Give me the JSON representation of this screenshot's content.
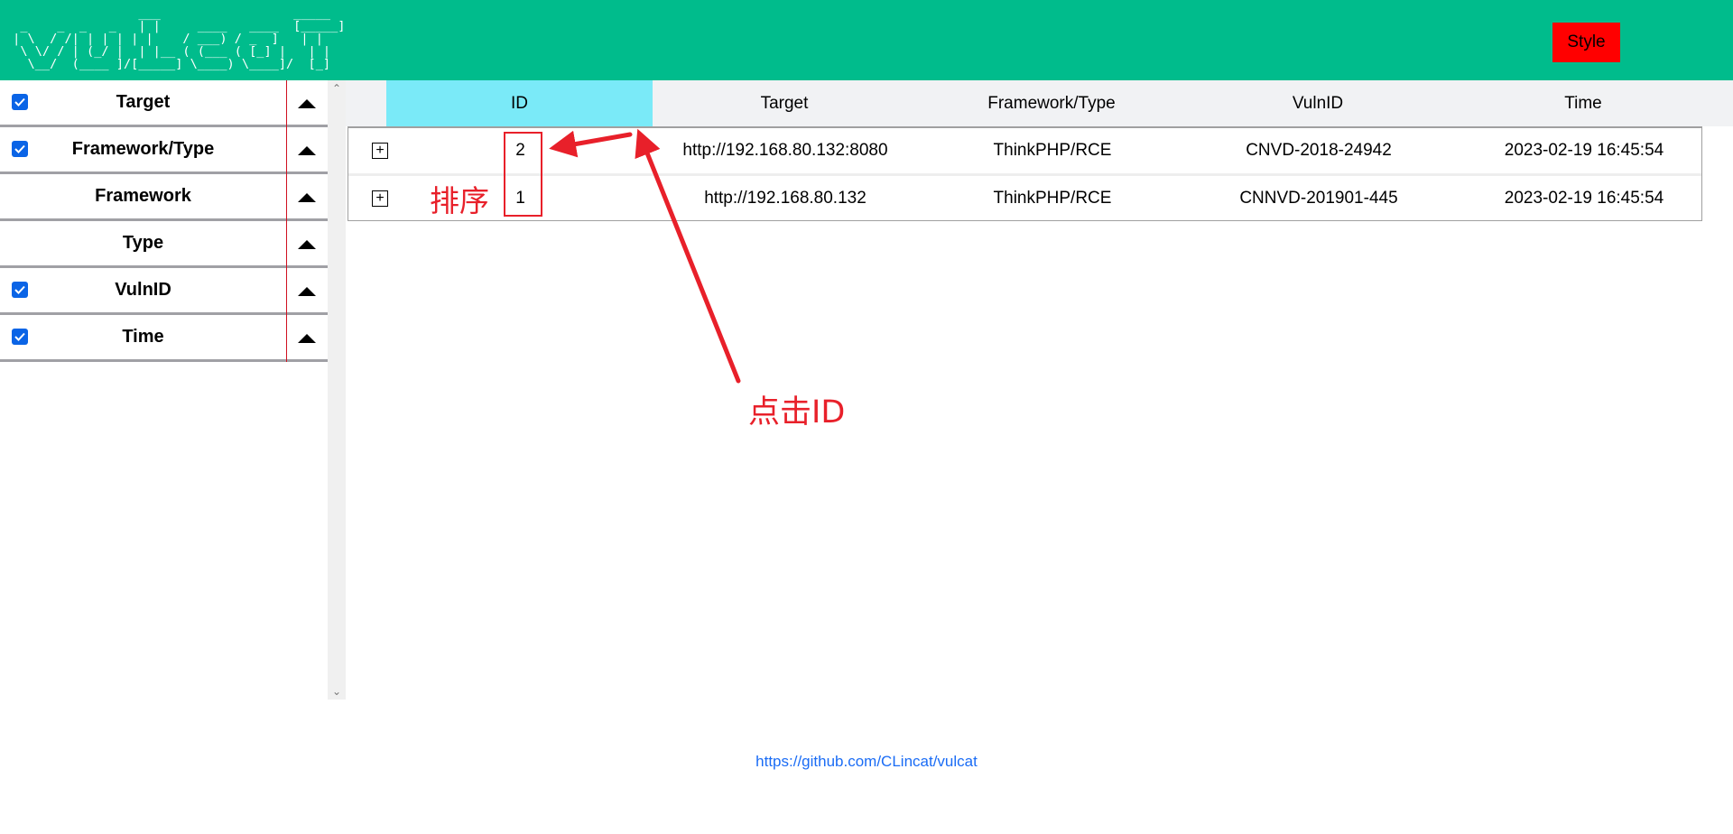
{
  "header": {
    "logo_lines": [
      "                  ___                  _____",
      "  _    _  _   _   | |     ____   ____  [_____]",
      " | \\  / /| | | | | |    / ___) / _  ]   | |",
      "  \\ \\/ / | (_/ |  | |__ ( (___ ( [_] |   | |",
      "   \\__/  (____ ]/[_____] \\____) \\____]/  [_]"
    ],
    "style_button": "Style"
  },
  "sidebar": {
    "items": [
      {
        "label": "Target",
        "checked": true
      },
      {
        "label": "Framework/Type",
        "checked": true
      },
      {
        "label": "Framework",
        "checked": false
      },
      {
        "label": "Type",
        "checked": false
      },
      {
        "label": "VulnID",
        "checked": true
      },
      {
        "label": "Time",
        "checked": true
      }
    ]
  },
  "table": {
    "columns": [
      "ID",
      "Target",
      "Framework/Type",
      "VulnID",
      "Time"
    ],
    "rows": [
      {
        "id": "2",
        "target": "http://192.168.80.132:8080",
        "framework_type": "ThinkPHP/RCE",
        "vulnid": "CNVD-2018-24942",
        "time": "2023-02-19 16:45:54"
      },
      {
        "id": "1",
        "target": "http://192.168.80.132",
        "framework_type": "ThinkPHP/RCE",
        "vulnid": "CNNVD-201901-445",
        "time": "2023-02-19 16:45:54"
      }
    ],
    "expand_symbol": "+"
  },
  "annotations": {
    "sort_label": "排序",
    "click_label": "点击ID"
  },
  "footer": {
    "link": "https://github.com/CLincat/vulcat"
  },
  "colors": {
    "header_bg": "#00bc8c",
    "style_button_bg": "#ff0000",
    "sorted_column_bg": "#7aeaf8",
    "annotation": "#e8202a",
    "link": "#1a6cf5"
  }
}
